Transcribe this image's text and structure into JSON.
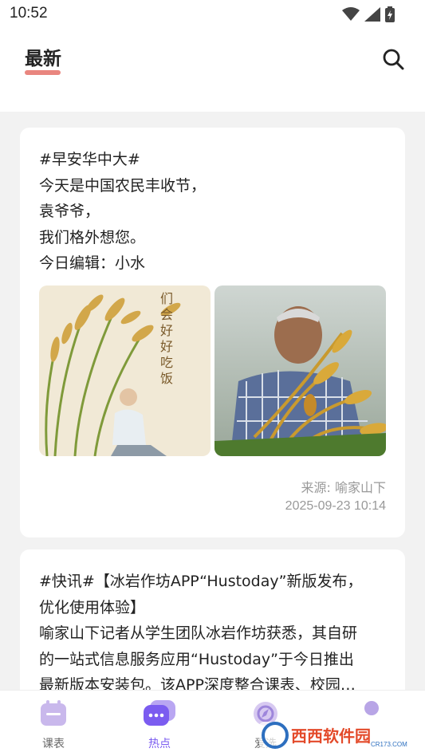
{
  "status_bar": {
    "time": "10:52"
  },
  "header": {
    "title": "最新"
  },
  "cards": [
    {
      "lines": [
        "#早安华中大#",
        "今天是中国农民丰收节，",
        "袁爷爷，",
        "我们格外想您。",
        "今日编辑：小水"
      ],
      "photo_1_caption": [
        "们",
        "会",
        "好",
        "好",
        "吃",
        "饭"
      ],
      "source": "来源: 喻家山下",
      "date": "2025-09-23 10:14"
    },
    {
      "lines": [
        "#快讯#【冰岩作坊APP“Hustoday”新版发布，",
        "优化使用体验】",
        "喻家山下记者从学生团队冰岩作坊获悉，其自研",
        "的一站式信息服务应用“Hustoday”于今日推出",
        "最新版本安装包。该APP深度整合课表、校园…"
      ]
    }
  ],
  "bottom_nav": [
    {
      "label": "课表",
      "icon": "schedule-icon",
      "active": false
    },
    {
      "label": "热点",
      "icon": "chat-icon",
      "active": true
    },
    {
      "label": "爱选",
      "icon": "compass-icon",
      "active": false
    },
    {
      "label": "",
      "icon": "profile-icon",
      "active": false
    }
  ],
  "watermark": {
    "text": "西西软件园",
    "sub": "CR173.COM"
  },
  "colors": {
    "accent": "#7b5cf0",
    "underline": "#e9867f",
    "muted": "#999999"
  }
}
